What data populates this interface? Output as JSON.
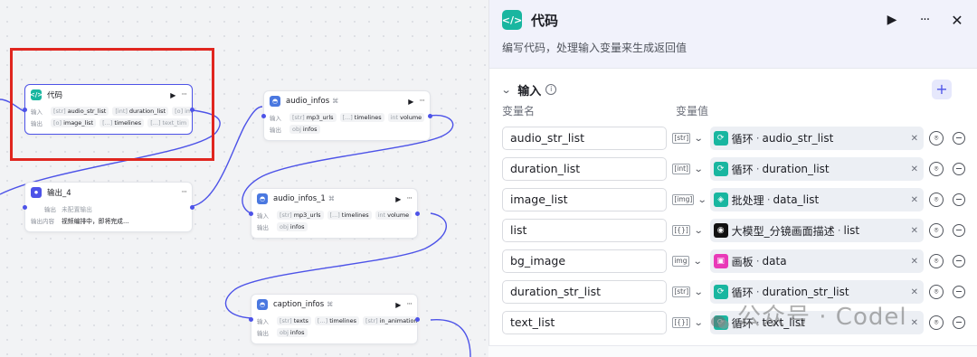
{
  "canvas": {
    "code_node": {
      "title": "代码",
      "input_label": "输入",
      "inputs": [
        {
          "type": "[str]",
          "name": "audio_str_list"
        },
        {
          "type": "[int]",
          "name": "duration_list"
        },
        {
          "type": "[o]",
          "name": "ima"
        }
      ],
      "output_label": "输出",
      "outputs": [
        {
          "type": "[o]",
          "name": "image_list"
        },
        {
          "type": "[...]",
          "name": "timelines"
        },
        {
          "type": "[...]",
          "name": "text_tim"
        }
      ]
    },
    "audio_infos": {
      "title": "audio_infos",
      "input_label": "输入",
      "inputs": [
        {
          "type": "[str]",
          "name": "mp3_urls"
        },
        {
          "type": "[...]",
          "name": "timelines"
        },
        {
          "type": "int",
          "name": "volume"
        }
      ],
      "output_label": "输出",
      "outputs": [
        {
          "type": "obj",
          "name": "infos"
        }
      ]
    },
    "output_4": {
      "title": "输出_4",
      "output_label": "输出",
      "output_value": "未配置输出",
      "content_label": "输出内容",
      "content_value": "视频编排中，即将完成..."
    },
    "audio_infos_1": {
      "title": "audio_infos_1",
      "input_label": "输入",
      "inputs": [
        {
          "type": "[str]",
          "name": "mp3_urls"
        },
        {
          "type": "[...]",
          "name": "timelines"
        },
        {
          "type": "int",
          "name": "volume"
        }
      ],
      "output_label": "输出",
      "outputs": [
        {
          "type": "obj",
          "name": "infos"
        }
      ]
    },
    "caption_infos": {
      "title": "caption_infos",
      "input_label": "输入",
      "inputs": [
        {
          "type": "[str]",
          "name": "texts"
        },
        {
          "type": "[...]",
          "name": "timelines"
        },
        {
          "type": "[str]",
          "name": "in_animation"
        }
      ],
      "output_label": "输出",
      "outputs": [
        {
          "type": "obj",
          "name": "infos"
        }
      ]
    }
  },
  "panel": {
    "title": "代码",
    "description": "编写代码，处理输入变量来生成返回值",
    "section_title": "输入",
    "col_name": "变量名",
    "col_value": "变量值",
    "rows": [
      {
        "name": "audio_str_list",
        "type": "[str]",
        "source_icon": "loop-icon",
        "source_color": "#19b6a0",
        "source_node": "循环",
        "source_var": "audio_str_list"
      },
      {
        "name": "duration_list",
        "type": "[int]",
        "source_icon": "loop-icon",
        "source_color": "#19b6a0",
        "source_node": "循环",
        "source_var": "duration_list"
      },
      {
        "name": "image_list",
        "type": "[img]",
        "source_icon": "batch-icon",
        "source_color": "#19b6a0",
        "source_node": "批处理",
        "source_var": "data_list"
      },
      {
        "name": "list",
        "type": "[{}]",
        "source_icon": "llm-icon",
        "source_color": "#111111",
        "source_node": "大模型_分镜画面描述",
        "source_var": "list"
      },
      {
        "name": "bg_image",
        "type": "img",
        "source_icon": "canvas-icon",
        "source_color": "#e93ab8",
        "source_node": "画板",
        "source_var": "data"
      },
      {
        "name": "duration_str_list",
        "type": "[str]",
        "source_icon": "loop-icon",
        "source_color": "#19b6a0",
        "source_node": "循环",
        "source_var": "duration_str_list"
      },
      {
        "name": "text_list",
        "type": "[{}]",
        "source_icon": "loop-icon",
        "source_color": "#19b6a0",
        "source_node": "循环",
        "source_var": "text_list"
      }
    ]
  },
  "watermark": "公众号 · Codel"
}
